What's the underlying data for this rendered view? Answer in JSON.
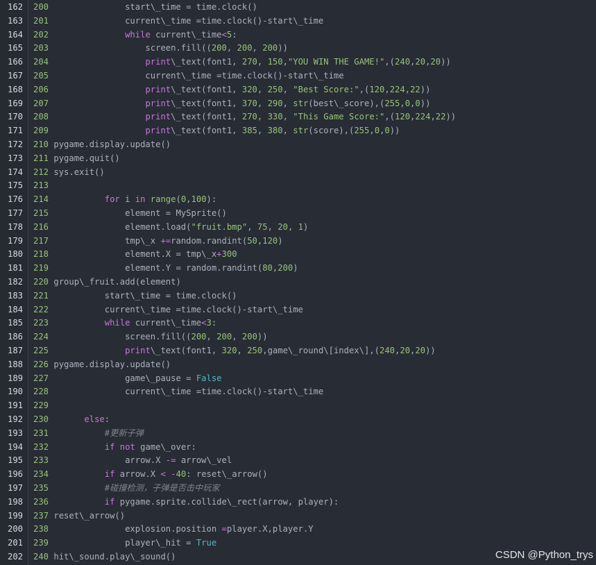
{
  "watermark": "CSDN @Python_trys",
  "colors": {
    "background": "#282c34",
    "keyword": "#c678dd",
    "number": "#98c379",
    "string": "#98c379",
    "comment": "#7f848e",
    "bool": "#56b6c2",
    "plain": "#abb2bf"
  },
  "lines": [
    {
      "gutter": "162",
      "tokens": [
        [
          "ln",
          "200 "
        ],
        [
          "plain",
          "              start\\_time = time.clock()"
        ]
      ]
    },
    {
      "gutter": "163",
      "tokens": [
        [
          "ln",
          "201 "
        ],
        [
          "plain",
          "              current\\_time =time.clock()-start\\_time"
        ]
      ]
    },
    {
      "gutter": "164",
      "tokens": [
        [
          "ln",
          "202 "
        ],
        [
          "plain",
          "              "
        ],
        [
          "kw",
          "while"
        ],
        [
          "plain",
          " current\\_time"
        ],
        [
          "op",
          "<"
        ],
        [
          "num",
          "5"
        ],
        [
          "plain",
          ":"
        ]
      ]
    },
    {
      "gutter": "165",
      "tokens": [
        [
          "ln",
          "203 "
        ],
        [
          "plain",
          "                  screen.fill(("
        ],
        [
          "num",
          "200"
        ],
        [
          "plain",
          ", "
        ],
        [
          "num",
          "200"
        ],
        [
          "plain",
          ", "
        ],
        [
          "num",
          "200"
        ],
        [
          "plain",
          "))"
        ]
      ]
    },
    {
      "gutter": "166",
      "tokens": [
        [
          "ln",
          "204 "
        ],
        [
          "plain",
          "                  "
        ],
        [
          "fn",
          "print"
        ],
        [
          "plain",
          "\\_text(font1, "
        ],
        [
          "num",
          "270"
        ],
        [
          "plain",
          ", "
        ],
        [
          "num",
          "150"
        ],
        [
          "plain",
          ","
        ],
        [
          "str",
          "\"YOU WIN THE GAME!\""
        ],
        [
          "plain",
          ",("
        ],
        [
          "num",
          "240"
        ],
        [
          "plain",
          ","
        ],
        [
          "num",
          "20"
        ],
        [
          "plain",
          ","
        ],
        [
          "num",
          "20"
        ],
        [
          "plain",
          "))"
        ]
      ]
    },
    {
      "gutter": "167",
      "tokens": [
        [
          "ln",
          "205 "
        ],
        [
          "plain",
          "                  current\\_time =time.clock()-start\\_time"
        ]
      ]
    },
    {
      "gutter": "168",
      "tokens": [
        [
          "ln",
          "206 "
        ],
        [
          "plain",
          "                  "
        ],
        [
          "fn",
          "print"
        ],
        [
          "plain",
          "\\_text(font1, "
        ],
        [
          "num",
          "320"
        ],
        [
          "plain",
          ", "
        ],
        [
          "num",
          "250"
        ],
        [
          "plain",
          ", "
        ],
        [
          "str",
          "\"Best Score:\""
        ],
        [
          "plain",
          ",("
        ],
        [
          "num",
          "120"
        ],
        [
          "plain",
          ","
        ],
        [
          "num",
          "224"
        ],
        [
          "plain",
          ","
        ],
        [
          "num",
          "22"
        ],
        [
          "plain",
          "))"
        ]
      ]
    },
    {
      "gutter": "169",
      "tokens": [
        [
          "ln",
          "207 "
        ],
        [
          "plain",
          "                  "
        ],
        [
          "fn",
          "print"
        ],
        [
          "plain",
          "\\_text(font1, "
        ],
        [
          "num",
          "370"
        ],
        [
          "plain",
          ", "
        ],
        [
          "num",
          "290"
        ],
        [
          "plain",
          ", "
        ],
        [
          "num",
          "str"
        ],
        [
          "plain",
          "(best\\_score),("
        ],
        [
          "num",
          "255"
        ],
        [
          "plain",
          ","
        ],
        [
          "num",
          "0"
        ],
        [
          "plain",
          ","
        ],
        [
          "num",
          "0"
        ],
        [
          "plain",
          "))"
        ]
      ]
    },
    {
      "gutter": "170",
      "tokens": [
        [
          "ln",
          "208 "
        ],
        [
          "plain",
          "                  "
        ],
        [
          "fn",
          "print"
        ],
        [
          "plain",
          "\\_text(font1, "
        ],
        [
          "num",
          "270"
        ],
        [
          "plain",
          ", "
        ],
        [
          "num",
          "330"
        ],
        [
          "plain",
          ", "
        ],
        [
          "str",
          "\"This Game Score:\""
        ],
        [
          "plain",
          ",("
        ],
        [
          "num",
          "120"
        ],
        [
          "plain",
          ","
        ],
        [
          "num",
          "224"
        ],
        [
          "plain",
          ","
        ],
        [
          "num",
          "22"
        ],
        [
          "plain",
          "))"
        ]
      ]
    },
    {
      "gutter": "171",
      "tokens": [
        [
          "ln",
          "209 "
        ],
        [
          "plain",
          "                  "
        ],
        [
          "fn",
          "print"
        ],
        [
          "plain",
          "\\_text(font1, "
        ],
        [
          "num",
          "385"
        ],
        [
          "plain",
          ", "
        ],
        [
          "num",
          "380"
        ],
        [
          "plain",
          ", "
        ],
        [
          "num",
          "str"
        ],
        [
          "plain",
          "(score),("
        ],
        [
          "num",
          "255"
        ],
        [
          "plain",
          ","
        ],
        [
          "num",
          "0"
        ],
        [
          "plain",
          ","
        ],
        [
          "num",
          "0"
        ],
        [
          "plain",
          "))"
        ]
      ]
    },
    {
      "gutter": "172",
      "tokens": [
        [
          "ln",
          "210 "
        ],
        [
          "plain",
          "pygame.display.update()"
        ]
      ]
    },
    {
      "gutter": "173",
      "tokens": [
        [
          "ln",
          "211 "
        ],
        [
          "plain",
          "pygame.quit()"
        ]
      ]
    },
    {
      "gutter": "174",
      "tokens": [
        [
          "ln",
          "212 "
        ],
        [
          "plain",
          "sys.exit()"
        ]
      ]
    },
    {
      "gutter": "175",
      "tokens": [
        [
          "ln",
          "213 "
        ]
      ]
    },
    {
      "gutter": "176",
      "tokens": [
        [
          "ln",
          "214 "
        ],
        [
          "plain",
          "          "
        ],
        [
          "kw",
          "for"
        ],
        [
          "plain",
          " i "
        ],
        [
          "kw",
          "in"
        ],
        [
          "plain",
          " "
        ],
        [
          "num",
          "range"
        ],
        [
          "plain",
          "("
        ],
        [
          "num",
          "0"
        ],
        [
          "plain",
          ","
        ],
        [
          "num",
          "100"
        ],
        [
          "plain",
          "):"
        ]
      ]
    },
    {
      "gutter": "177",
      "tokens": [
        [
          "ln",
          "215 "
        ],
        [
          "plain",
          "              element = MySprite()"
        ]
      ]
    },
    {
      "gutter": "178",
      "tokens": [
        [
          "ln",
          "216 "
        ],
        [
          "plain",
          "              element.load("
        ],
        [
          "str",
          "\"fruit.bmp\""
        ],
        [
          "plain",
          ", "
        ],
        [
          "num",
          "75"
        ],
        [
          "plain",
          ", "
        ],
        [
          "num",
          "20"
        ],
        [
          "plain",
          ", "
        ],
        [
          "num",
          "1"
        ],
        [
          "plain",
          ")"
        ]
      ]
    },
    {
      "gutter": "179",
      "tokens": [
        [
          "ln",
          "217 "
        ],
        [
          "plain",
          "              tmp\\_x "
        ],
        [
          "op",
          "+="
        ],
        [
          "plain",
          "random.randint("
        ],
        [
          "num",
          "50"
        ],
        [
          "plain",
          ","
        ],
        [
          "num",
          "120"
        ],
        [
          "plain",
          ")"
        ]
      ]
    },
    {
      "gutter": "180",
      "tokens": [
        [
          "ln",
          "218 "
        ],
        [
          "plain",
          "              element.X = tmp\\_x"
        ],
        [
          "op",
          "+"
        ],
        [
          "num",
          "300"
        ]
      ]
    },
    {
      "gutter": "181",
      "tokens": [
        [
          "ln",
          "219 "
        ],
        [
          "plain",
          "              element.Y = random.randint("
        ],
        [
          "num",
          "80"
        ],
        [
          "plain",
          ","
        ],
        [
          "num",
          "200"
        ],
        [
          "plain",
          ")"
        ]
      ]
    },
    {
      "gutter": "182",
      "tokens": [
        [
          "ln",
          "220 "
        ],
        [
          "plain",
          "group\\_fruit.add(element)"
        ]
      ]
    },
    {
      "gutter": "183",
      "tokens": [
        [
          "ln",
          "221 "
        ],
        [
          "plain",
          "          start\\_time = time.clock()"
        ]
      ]
    },
    {
      "gutter": "184",
      "tokens": [
        [
          "ln",
          "222 "
        ],
        [
          "plain",
          "          current\\_time =time.clock()-start\\_time"
        ]
      ]
    },
    {
      "gutter": "185",
      "tokens": [
        [
          "ln",
          "223 "
        ],
        [
          "plain",
          "          "
        ],
        [
          "kw",
          "while"
        ],
        [
          "plain",
          " current\\_time"
        ],
        [
          "op",
          "<"
        ],
        [
          "num",
          "3"
        ],
        [
          "plain",
          ":"
        ]
      ]
    },
    {
      "gutter": "186",
      "tokens": [
        [
          "ln",
          "224 "
        ],
        [
          "plain",
          "              screen.fill(("
        ],
        [
          "num",
          "200"
        ],
        [
          "plain",
          ", "
        ],
        [
          "num",
          "200"
        ],
        [
          "plain",
          ", "
        ],
        [
          "num",
          "200"
        ],
        [
          "plain",
          "))"
        ]
      ]
    },
    {
      "gutter": "187",
      "tokens": [
        [
          "ln",
          "225 "
        ],
        [
          "plain",
          "              "
        ],
        [
          "fn",
          "print"
        ],
        [
          "plain",
          "\\_text(font1, "
        ],
        [
          "num",
          "320"
        ],
        [
          "plain",
          ", "
        ],
        [
          "num",
          "250"
        ],
        [
          "plain",
          ",game\\_round\\[index\\],("
        ],
        [
          "num",
          "240"
        ],
        [
          "plain",
          ","
        ],
        [
          "num",
          "20"
        ],
        [
          "plain",
          ","
        ],
        [
          "num",
          "20"
        ],
        [
          "plain",
          "))"
        ]
      ]
    },
    {
      "gutter": "188",
      "tokens": [
        [
          "ln",
          "226 "
        ],
        [
          "plain",
          "pygame.display.update()"
        ]
      ]
    },
    {
      "gutter": "189",
      "tokens": [
        [
          "ln",
          "227 "
        ],
        [
          "plain",
          "              game\\_pause = "
        ],
        [
          "bool",
          "False"
        ]
      ]
    },
    {
      "gutter": "190",
      "tokens": [
        [
          "ln",
          "228 "
        ],
        [
          "plain",
          "              current\\_time =time.clock()-start\\_time"
        ]
      ]
    },
    {
      "gutter": "191",
      "tokens": [
        [
          "ln",
          "229 "
        ]
      ]
    },
    {
      "gutter": "192",
      "tokens": [
        [
          "ln",
          "230 "
        ],
        [
          "plain",
          "      "
        ],
        [
          "kw",
          "else"
        ],
        [
          "plain",
          ":"
        ]
      ]
    },
    {
      "gutter": "193",
      "tokens": [
        [
          "ln",
          "231 "
        ],
        [
          "plain",
          "          "
        ],
        [
          "cmt",
          "#更新子弹"
        ]
      ]
    },
    {
      "gutter": "194",
      "tokens": [
        [
          "ln",
          "232 "
        ],
        [
          "plain",
          "          "
        ],
        [
          "kw",
          "if"
        ],
        [
          "plain",
          " "
        ],
        [
          "kw",
          "not"
        ],
        [
          "plain",
          " game\\_over:"
        ]
      ]
    },
    {
      "gutter": "195",
      "tokens": [
        [
          "ln",
          "233 "
        ],
        [
          "plain",
          "              arrow.X "
        ],
        [
          "op",
          "-="
        ],
        [
          "plain",
          " arrow\\_vel"
        ]
      ]
    },
    {
      "gutter": "196",
      "tokens": [
        [
          "ln",
          "234 "
        ],
        [
          "plain",
          "          "
        ],
        [
          "kw",
          "if"
        ],
        [
          "plain",
          " arrow.X "
        ],
        [
          "op",
          "<"
        ],
        [
          "plain",
          " "
        ],
        [
          "op",
          "-"
        ],
        [
          "num",
          "40"
        ],
        [
          "plain",
          ": reset\\_arrow()"
        ]
      ]
    },
    {
      "gutter": "197",
      "tokens": [
        [
          "ln",
          "235 "
        ],
        [
          "plain",
          "          "
        ],
        [
          "cmt",
          "#碰撞检测，子弹是否击中玩家"
        ]
      ]
    },
    {
      "gutter": "198",
      "tokens": [
        [
          "ln",
          "236 "
        ],
        [
          "plain",
          "          "
        ],
        [
          "kw",
          "if"
        ],
        [
          "plain",
          " pygame.sprite.collide\\_rect(arrow, player):"
        ]
      ]
    },
    {
      "gutter": "199",
      "tokens": [
        [
          "ln",
          "237 "
        ],
        [
          "plain",
          "reset\\_arrow()"
        ]
      ]
    },
    {
      "gutter": "200",
      "tokens": [
        [
          "ln",
          "238 "
        ],
        [
          "plain",
          "              explosion.position "
        ],
        [
          "op",
          "="
        ],
        [
          "plain",
          "player.X,player.Y"
        ]
      ]
    },
    {
      "gutter": "201",
      "tokens": [
        [
          "ln",
          "239 "
        ],
        [
          "plain",
          "              player\\_hit = "
        ],
        [
          "bool",
          "True"
        ]
      ]
    },
    {
      "gutter": "202",
      "tokens": [
        [
          "ln",
          "240 "
        ],
        [
          "plain",
          "hit\\_sound.play\\_sound()"
        ]
      ]
    }
  ]
}
